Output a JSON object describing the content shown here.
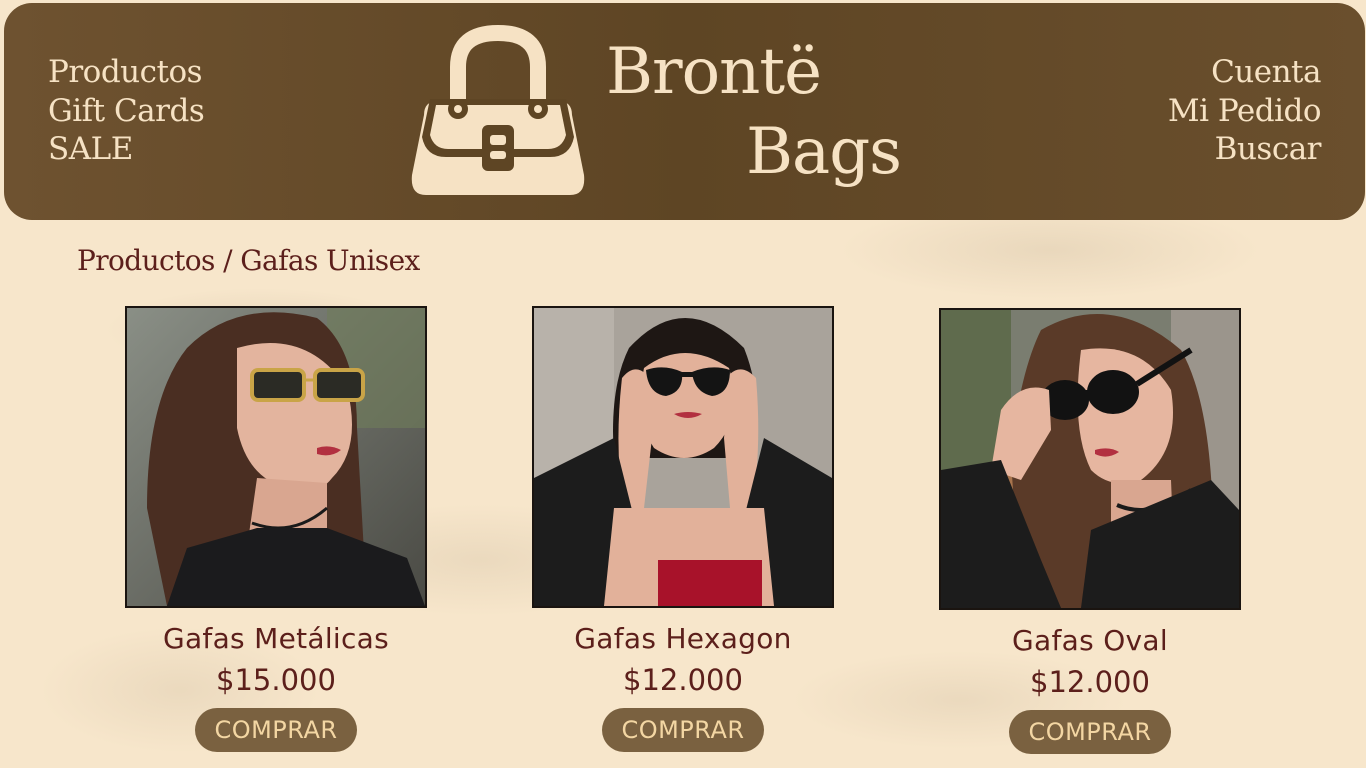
{
  "colors": {
    "background": "#f7e6cb",
    "header": "#654a28",
    "header_text": "#f6e2c4",
    "text": "#5c1f1b",
    "button": "#7a6140",
    "button_text": "#f3d6a3"
  },
  "header": {
    "nav_left": [
      "Productos",
      "Gift Cards",
      "SALE"
    ],
    "nav_right": [
      "Cuenta",
      "Mi Pedido",
      "Buscar"
    ],
    "logo_icon": "handbag-icon",
    "brand_line1": "Brontë",
    "brand_line2": "Bags"
  },
  "breadcrumb": "Productos / Gafas Unisex",
  "products": [
    {
      "name": "Gafas Metálicas",
      "price": "$15.000",
      "button": "COMPRAR",
      "photo": "woman-gold-square-sunglasses-photo"
    },
    {
      "name": "Gafas Hexagon",
      "price": "$12.000",
      "button": "COMPRAR",
      "photo": "woman-black-hexagon-sunglasses-photo"
    },
    {
      "name": "Gafas Oval",
      "price": "$12.000",
      "button": "COMPRAR",
      "photo": "woman-black-oval-sunglasses-photo"
    }
  ]
}
